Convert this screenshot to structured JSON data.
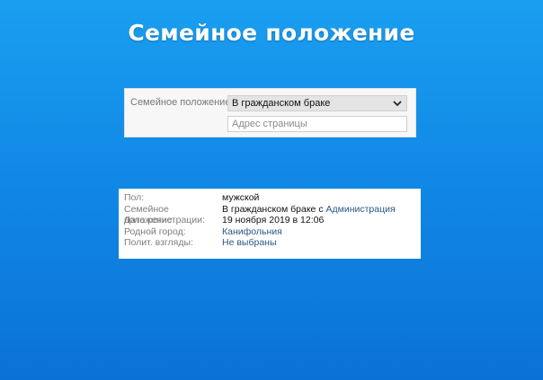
{
  "page": {
    "title": "Семейное положение"
  },
  "settings": {
    "status_label": "Семейное положение:",
    "status_selected": "В гражданском браке",
    "address_placeholder": "Адрес страницы"
  },
  "profile": {
    "gender_key": "Пол:",
    "gender_value": "мужской",
    "status_key": "Семейное положение:",
    "status_value_prefix": "В гражданском браке с",
    "status_partner_link": "Администрация",
    "registration_key": "Дата регистрации:",
    "registration_value": "19 ноября 2019 в 12:06",
    "hometown_key": "Родной город:",
    "hometown_link": "Канифольния",
    "politics_key": "Полит. взгляды:",
    "politics_link": "Не выбраны"
  },
  "colors": {
    "background_top": "#1a9ff0",
    "background_bottom": "#0a72d4",
    "link": "#2a5885"
  }
}
